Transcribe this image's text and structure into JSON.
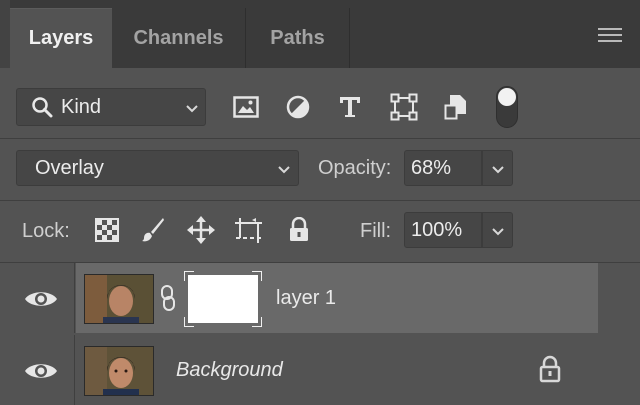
{
  "tabs": [
    {
      "label": "Layers",
      "active": true
    },
    {
      "label": "Channels",
      "active": false
    },
    {
      "label": "Paths",
      "active": false
    }
  ],
  "filter": {
    "kind_label": "Kind",
    "icons": [
      "image-filter-icon",
      "adjustment-filter-icon",
      "type-filter-icon",
      "shape-filter-icon",
      "smart-object-filter-icon"
    ],
    "toggle_on": true
  },
  "blend": {
    "mode": "Overlay",
    "opacity_label": "Opacity:",
    "opacity_value": "68%"
  },
  "lock": {
    "label": "Lock:",
    "icons": [
      "lock-transparent-pixels-icon",
      "lock-image-pixels-icon",
      "lock-position-icon",
      "lock-artboard-icon",
      "lock-all-icon"
    ],
    "fill_label": "Fill:",
    "fill_value": "100%"
  },
  "layers": [
    {
      "name": "layer 1",
      "visible": true,
      "selected": true,
      "has_mask": true,
      "locked": false
    },
    {
      "name": "Background",
      "visible": true,
      "selected": false,
      "has_mask": false,
      "locked": true
    }
  ],
  "colors": {
    "panel_bg": "#535353",
    "tab_bar_bg": "#3a3a3a",
    "selected_row_bg": "#696969",
    "text": "#e6e6e6"
  }
}
